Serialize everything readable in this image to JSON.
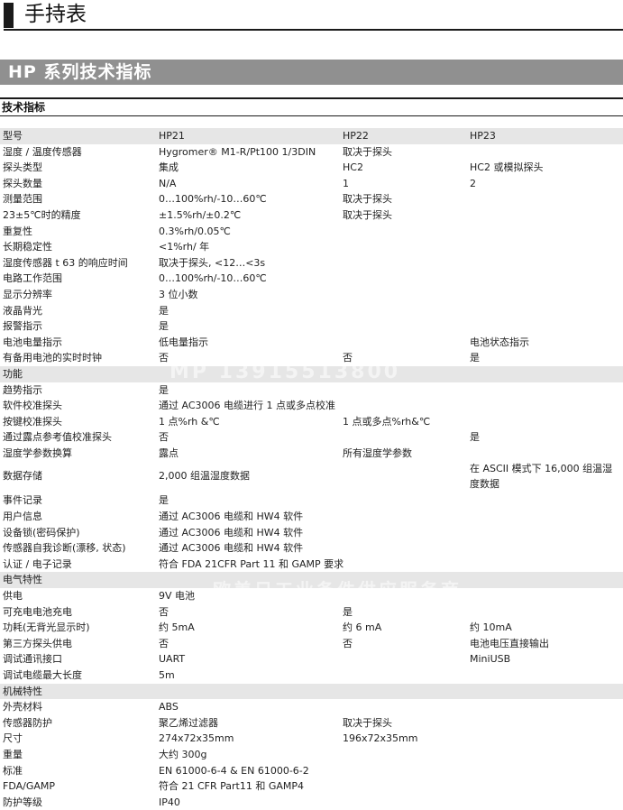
{
  "page_title": "手持表",
  "series_title": "HP  系列技术指标",
  "section_title": "技术指标",
  "rows": [
    {
      "type": "hdr",
      "cells": [
        "型号",
        "HP21",
        "HP22",
        "HP23"
      ]
    },
    {
      "type": "row",
      "cells": [
        "湿度 / 温度传感器",
        "Hygromer® M1-R/Pt100 1/3DIN",
        "取决于探头",
        ""
      ]
    },
    {
      "type": "row",
      "cells": [
        "探头类型",
        "集成",
        "HC2",
        "HC2 或模拟探头"
      ]
    },
    {
      "type": "row",
      "cells": [
        "探头数量",
        "N/A",
        "1",
        "2"
      ]
    },
    {
      "type": "row",
      "cells": [
        "测量范围",
        "0…100%rh/-10…60℃",
        "取决于探头",
        ""
      ]
    },
    {
      "type": "row",
      "cells": [
        "23±5℃时的精度",
        "±1.5%rh/±0.2℃",
        "取决于探头",
        ""
      ]
    },
    {
      "type": "row",
      "cells": [
        "重复性",
        "0.3%rh/0.05℃",
        "",
        ""
      ]
    },
    {
      "type": "row",
      "cells": [
        "长期稳定性",
        "<1%rh/ 年",
        "",
        ""
      ]
    },
    {
      "type": "row",
      "cells": [
        "湿度传感器 t 63 的响应时间",
        "取决于探头, <12…<3s",
        "",
        ""
      ]
    },
    {
      "type": "row",
      "cells": [
        "电路工作范围",
        "0…100%rh/-10…60℃",
        "",
        ""
      ]
    },
    {
      "type": "row",
      "cells": [
        "显示分辨率",
        "3 位小数",
        "",
        ""
      ]
    },
    {
      "type": "row",
      "cells": [
        "液晶背光",
        "是",
        "",
        ""
      ]
    },
    {
      "type": "row",
      "cells": [
        "报警指示",
        "是",
        "",
        ""
      ]
    },
    {
      "type": "row",
      "cells": [
        "电池电量指示",
        "低电量指示",
        "",
        "电池状态指示"
      ]
    },
    {
      "type": "row",
      "cells": [
        "有备用电池的实时时钟",
        "否",
        "否",
        "是"
      ]
    },
    {
      "type": "sec",
      "cells": [
        "功能",
        "",
        "",
        ""
      ]
    },
    {
      "type": "row",
      "cells": [
        "趋势指示",
        "是",
        "",
        ""
      ]
    },
    {
      "type": "row",
      "cells": [
        "软件校准探头",
        "通过 AC3006 电缆进行 1 点或多点校准",
        "",
        ""
      ]
    },
    {
      "type": "row",
      "cells": [
        "按键校准探头",
        "1 点%rh &℃",
        "1 点或多点%rh&℃",
        ""
      ]
    },
    {
      "type": "row",
      "cells": [
        "通过露点参考值校准探头",
        "否",
        "",
        "是"
      ]
    },
    {
      "type": "row",
      "cells": [
        "湿度学参数换算",
        "露点",
        "所有湿度学参数",
        ""
      ]
    },
    {
      "type": "tall",
      "cells": [
        "数据存储",
        "2,000 组温湿度数据",
        "",
        "在 ASCII 模式下 16,000 组温湿度数据"
      ]
    },
    {
      "type": "row",
      "cells": [
        "事件记录",
        "是",
        "",
        ""
      ]
    },
    {
      "type": "row",
      "cells": [
        "用户信息",
        "通过 AC3006 电缆和 HW4 软件",
        "",
        ""
      ]
    },
    {
      "type": "row",
      "cells": [
        "设备锁(密码保护)",
        "通过 AC3006 电缆和 HW4 软件",
        "",
        ""
      ]
    },
    {
      "type": "row",
      "cells": [
        "传感器自我诊断(漂移, 状态)",
        "通过 AC3006 电缆和 HW4 软件",
        "",
        ""
      ]
    },
    {
      "type": "row",
      "cells": [
        "认证 / 电子记录",
        "符合 FDA 21CFR Part 11 和 GAMP 要求",
        "",
        ""
      ]
    },
    {
      "type": "sec",
      "cells": [
        "电气特性",
        "",
        "",
        ""
      ]
    },
    {
      "type": "row",
      "cells": [
        "供电",
        "9V 电池",
        "",
        ""
      ]
    },
    {
      "type": "row",
      "cells": [
        "可充电电池充电",
        "否",
        "是",
        ""
      ]
    },
    {
      "type": "row",
      "cells": [
        "功耗(无背光显示时)",
        "约 5mA",
        "约 6 mA",
        "约 10mA"
      ]
    },
    {
      "type": "row",
      "cells": [
        "第三方探头供电",
        "否",
        "否",
        "电池电压直接输出"
      ]
    },
    {
      "type": "row",
      "cells": [
        "调试通讯接口",
        "UART",
        "",
        "MiniUSB"
      ]
    },
    {
      "type": "row",
      "cells": [
        "调试电缆最大长度",
        "5m",
        "",
        ""
      ]
    },
    {
      "type": "sec",
      "cells": [
        "机械特性",
        "",
        "",
        ""
      ]
    },
    {
      "type": "row",
      "cells": [
        "外壳材料",
        "ABS",
        "",
        ""
      ]
    },
    {
      "type": "row",
      "cells": [
        "传感器防护",
        "聚乙烯过滤器",
        "取决于探头",
        ""
      ]
    },
    {
      "type": "row",
      "cells": [
        "尺寸",
        "274x72x35mm",
        "196x72x35mm",
        ""
      ]
    },
    {
      "type": "row",
      "cells": [
        "重量",
        "大约 300g",
        "",
        ""
      ]
    },
    {
      "type": "row",
      "cells": [
        "标准",
        "EN 61000-6-4 & EN 61000-6-2",
        "",
        ""
      ]
    },
    {
      "type": "row",
      "cells": [
        "FDA/GAMP",
        "符合 21 CFR Part11 和 GAMP4",
        "",
        ""
      ]
    },
    {
      "type": "row",
      "cells": [
        "防护等级",
        "IP40",
        "",
        ""
      ]
    }
  ],
  "watermark_1": "MP 13915513800",
  "watermark_2": "欧美日工业备件供应服务商"
}
